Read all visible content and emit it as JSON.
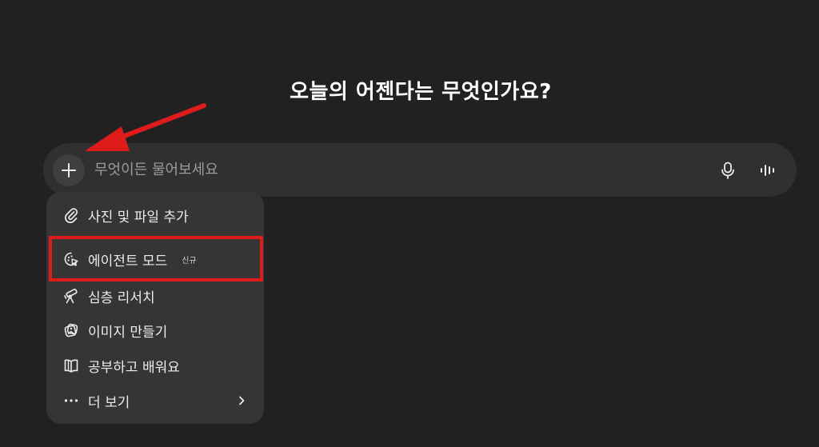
{
  "headline": "오늘의 어젠다는 무엇인가요?",
  "composer": {
    "placeholder": "무엇이든 물어보세요",
    "value": "",
    "icons": {
      "plus": "plus-icon",
      "mic": "microphone-icon",
      "voice": "voice-waveform-icon"
    }
  },
  "menu": {
    "items": [
      {
        "label": "사진 및 파일 추가",
        "icon": "paperclip-icon"
      },
      {
        "label": "에이전트 모드",
        "icon": "agent-cursor-icon",
        "badge": "신규"
      },
      {
        "label": "심층 리서치",
        "icon": "telescope-icon"
      },
      {
        "label": "이미지 만들기",
        "icon": "image-create-icon"
      },
      {
        "label": "공부하고 배워요",
        "icon": "open-book-icon"
      },
      {
        "label": "더 보기",
        "icon": "more-dots-icon",
        "trailing_icon": "chevron-right-icon"
      }
    ]
  },
  "annotation": {
    "highlight_color": "#e01b1b",
    "arrow_color": "#e01b1b"
  },
  "colors": {
    "background": "#212121",
    "composer_bg": "#303030",
    "menu_bg": "#353535",
    "text": "#ececec",
    "placeholder": "#9b9b9b"
  }
}
